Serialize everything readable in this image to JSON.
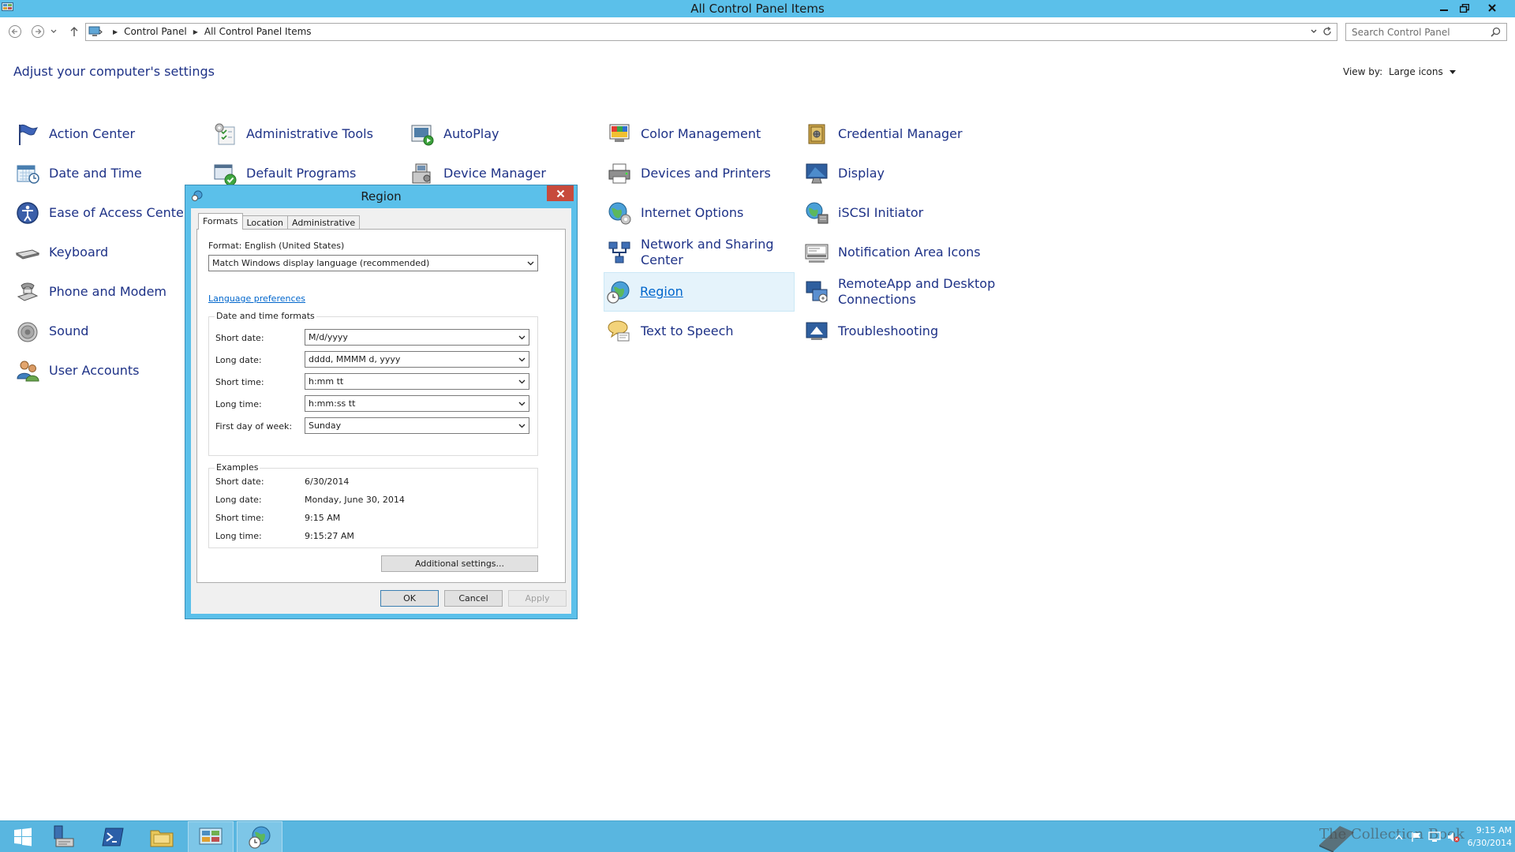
{
  "window": {
    "title": "All Control Panel Items"
  },
  "address": {
    "crumbs": [
      "Control Panel",
      "All Control Panel Items"
    ],
    "search_placeholder": "Search Control Panel"
  },
  "header": {
    "title": "Adjust your computer's settings",
    "view_by_label": "View by:",
    "view_by_value": "Large icons"
  },
  "items": {
    "c1": [
      "Action Center",
      "Date and Time",
      "Ease of Access Center",
      "Keyboard",
      "Phone and Modem",
      "Sound",
      "User Accounts"
    ],
    "c2": [
      "Administrative Tools",
      "Default Programs"
    ],
    "c3": [
      "AutoPlay",
      "Device Manager"
    ],
    "c4": [
      "Color Management",
      "Devices and Printers",
      "Internet Options",
      "Network and Sharing Center",
      "Region",
      "Text to Speech"
    ],
    "c5": [
      "Credential Manager",
      "Display",
      "iSCSI Initiator",
      "Notification Area Icons",
      "RemoteApp and Desktop Connections",
      "Troubleshooting"
    ],
    "selected": "Region"
  },
  "dialog": {
    "title": "Region",
    "tabs": [
      "Formats",
      "Location",
      "Administrative"
    ],
    "format_label": "Format: English (United States)",
    "format_value": "Match Windows display language (recommended)",
    "lang_link": "Language preferences",
    "dt_group": "Date and time formats",
    "fields": [
      {
        "label": "Short date:",
        "value": "M/d/yyyy"
      },
      {
        "label": "Long date:",
        "value": "dddd, MMMM d, yyyy"
      },
      {
        "label": "Short time:",
        "value": "h:mm tt"
      },
      {
        "label": "Long time:",
        "value": "h:mm:ss tt"
      },
      {
        "label": "First day of week:",
        "value": "Sunday"
      }
    ],
    "examples_group": "Examples",
    "examples": [
      {
        "label": "Short date:",
        "value": "6/30/2014"
      },
      {
        "label": "Long date:",
        "value": "Monday, June 30, 2014"
      },
      {
        "label": "Short time:",
        "value": "9:15 AM"
      },
      {
        "label": "Long time:",
        "value": "9:15:27 AM"
      }
    ],
    "additional_btn": "Additional settings...",
    "ok": "OK",
    "cancel": "Cancel",
    "apply": "Apply"
  },
  "taskbar": {
    "time": "9:15 AM",
    "date": "6/30/2014",
    "watermark": "The Collection Book"
  },
  "colors": {
    "titlebar": "#5bc0ea",
    "taskbar": "#59b6e0",
    "link": "#1e3287"
  }
}
